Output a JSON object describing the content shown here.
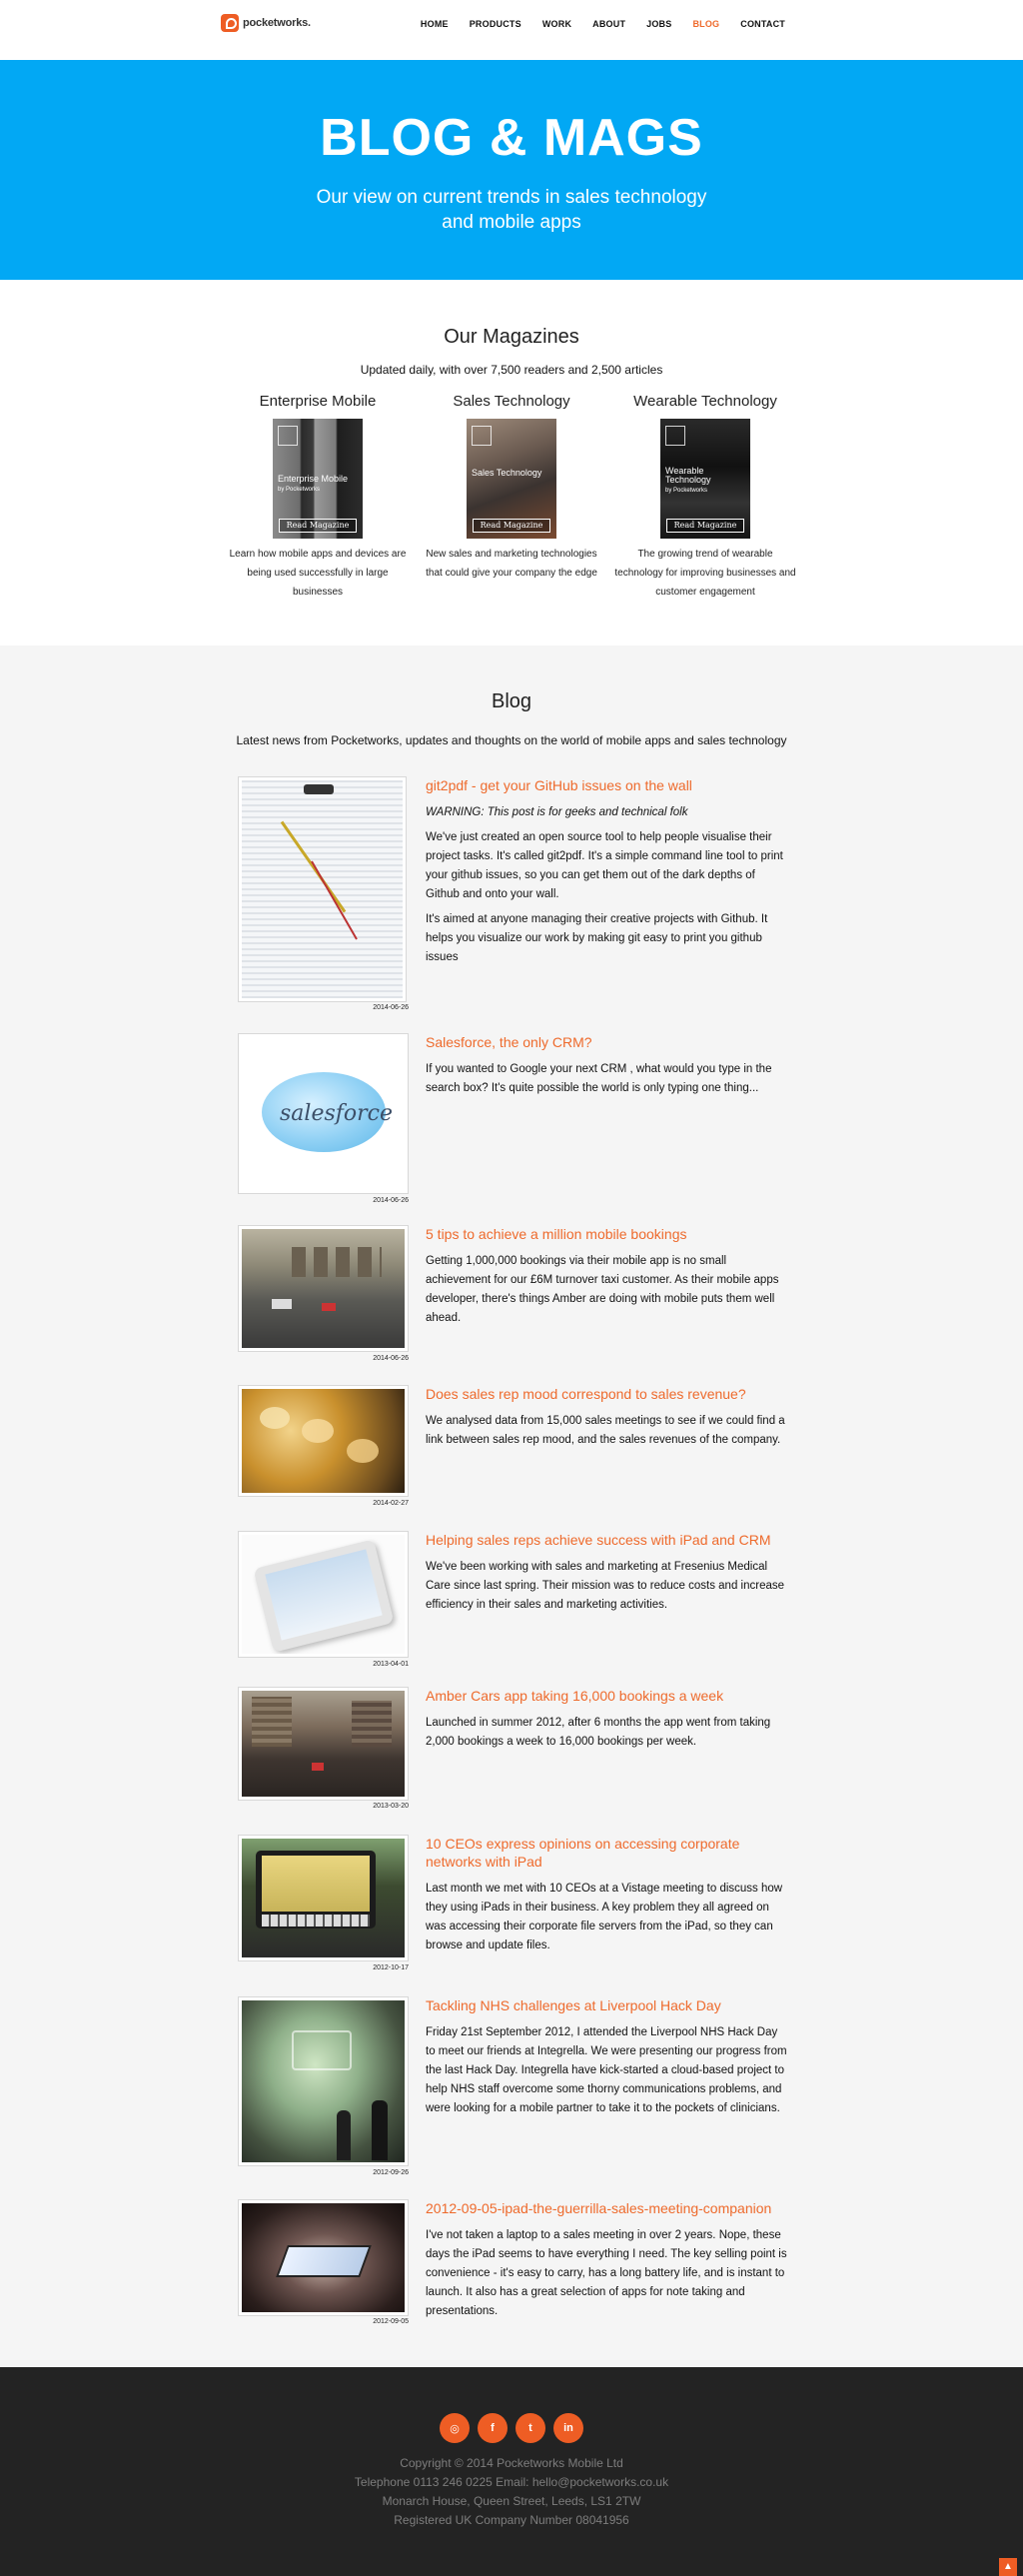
{
  "brand": {
    "name": "pocketworks."
  },
  "nav": [
    "HOME",
    "PRODUCTS",
    "WORK",
    "ABOUT",
    "JOBS",
    "BLOG",
    "CONTACT"
  ],
  "nav_active": "BLOG",
  "hero": {
    "title": "BLOG & MAGS",
    "subtitle_line1": "Our view on current trends in sales technology",
    "subtitle_line2": "and mobile apps"
  },
  "magazines": {
    "title": "Our Magazines",
    "subtitle": "Updated daily, with over 7,500 readers and 2,500 articles",
    "items": [
      {
        "name": "Enterprise Mobile",
        "cover_title": "Enterprise Mobile",
        "cover_sub": "by Pocketworks",
        "button": "Read Magazine",
        "desc": "Learn how mobile apps and devices are being used successfully in large businesses"
      },
      {
        "name": "Sales Technology",
        "cover_title": "Sales Technology",
        "cover_sub": "",
        "button": "Read Magazine",
        "desc": "New sales and marketing technologies that could give your company the edge"
      },
      {
        "name": "Wearable Technology",
        "cover_title": "Wearable Technology",
        "cover_sub": "by Pocketworks",
        "button": "Read Magazine",
        "desc": "The growing trend of wearable technology for improving businesses and customer engagement"
      }
    ]
  },
  "blog": {
    "title": "Blog",
    "subtitle": "Latest news from Pocketworks, updates and thoughts on the world of mobile apps and sales technology",
    "posts": [
      {
        "title": "git2pdf - get your GitHub issues on the wall",
        "warning": "WARNING: This post is for geeks and technical folk",
        "paragraphs": [
          "We've just created an open source tool to help people visualise their project tasks. It's called git2pdf. It's a simple command line tool to print your github issues, so you can get them out of the dark depths of Github and onto your wall.",
          "It's aimed at anyone managing their creative projects with Github. It helps you visualize our work by making git easy to print you github issues"
        ],
        "date": "2014-06-26"
      },
      {
        "title": "Salesforce, the only CRM?",
        "warning": "",
        "paragraphs": [
          "If you wanted to Google your next CRM , what would you type in the search box? It's quite possible the world is only typing one thing..."
        ],
        "date": "2014-06-26"
      },
      {
        "title": "5 tips to achieve a million mobile bookings",
        "warning": "",
        "paragraphs": [
          "Getting 1,000,000 bookings via their mobile app is no small achievement for our £6M turnover taxi customer. As their mobile apps developer, there's things Amber are doing with mobile puts them well ahead."
        ],
        "date": "2014-06-26"
      },
      {
        "title": "Does sales rep mood correspond to sales revenue?",
        "warning": "",
        "paragraphs": [
          "We analysed data from 15,000 sales meetings to see if we could find a link between sales rep mood, and the sales revenues of the company."
        ],
        "date": "2014-02-27"
      },
      {
        "title": "Helping sales reps achieve success with iPad and CRM",
        "warning": "",
        "paragraphs": [
          "We've been working with sales and marketing at Fresenius Medical Care since last spring. Their mission was to reduce costs and increase efficiency in their sales and marketing activities."
        ],
        "date": "2013-04-01"
      },
      {
        "title": "Amber Cars app taking 16,000 bookings a week",
        "warning": "",
        "paragraphs": [
          "Launched in summer 2012, after 6 months the app went from taking 2,000 bookings a week to 16,000 bookings per week."
        ],
        "date": "2013-03-20"
      },
      {
        "title": "10 CEOs express opinions on accessing corporate networks with iPad",
        "warning": "",
        "paragraphs": [
          "Last month we met with 10 CEOs at a Vistage meeting to discuss how they using iPads in their business. A key problem they all agreed on was accessing their corporate file servers from the iPad, so they can browse and update files."
        ],
        "date": "2012-10-17"
      },
      {
        "title": "Tackling NHS challenges at Liverpool Hack Day",
        "warning": "",
        "paragraphs": [
          "Friday 21st September 2012, I attended the Liverpool NHS Hack Day to meet our friends at Integrella. We were presenting our progress from the last Hack Day. Integrella have kick-started a cloud-based project to help NHS staff overcome some thorny communications problems, and were looking for a mobile partner to take it to the pockets of clinicians."
        ],
        "date": "2012-09-26"
      },
      {
        "title": "2012-09-05-ipad-the-guerrilla-sales-meeting-companion",
        "warning": "",
        "paragraphs": [
          "I've not taken a laptop to a sales meeting in over 2 years. Nope, these days the iPad seems to have everything I need. The key selling point is convenience - it's easy to carry, has a long battery life, and is instant to launch. It also has a great selection of apps for note taking and presentations."
        ],
        "date": "2012-09-05"
      }
    ]
  },
  "footer": {
    "socials": [
      "rss-icon",
      "facebook-icon",
      "twitter-icon",
      "linkedin-icon"
    ],
    "social_glyphs": [
      "◎",
      "f",
      "t",
      "in"
    ],
    "lines": [
      "Copyright © 2014 Pocketworks Mobile Ltd",
      "Telephone 0113 246 0225 Email: hello@pocketworks.co.uk",
      "Monarch House, Queen Street, Leeds, LS1 2TW",
      "Registered UK Company Number 08041956"
    ],
    "to_top": "▲"
  },
  "colors": {
    "hero": "#02a8f4",
    "accent": "#ee6a2c",
    "footer": "#232323",
    "blog_bg": "#f5f5f5"
  }
}
